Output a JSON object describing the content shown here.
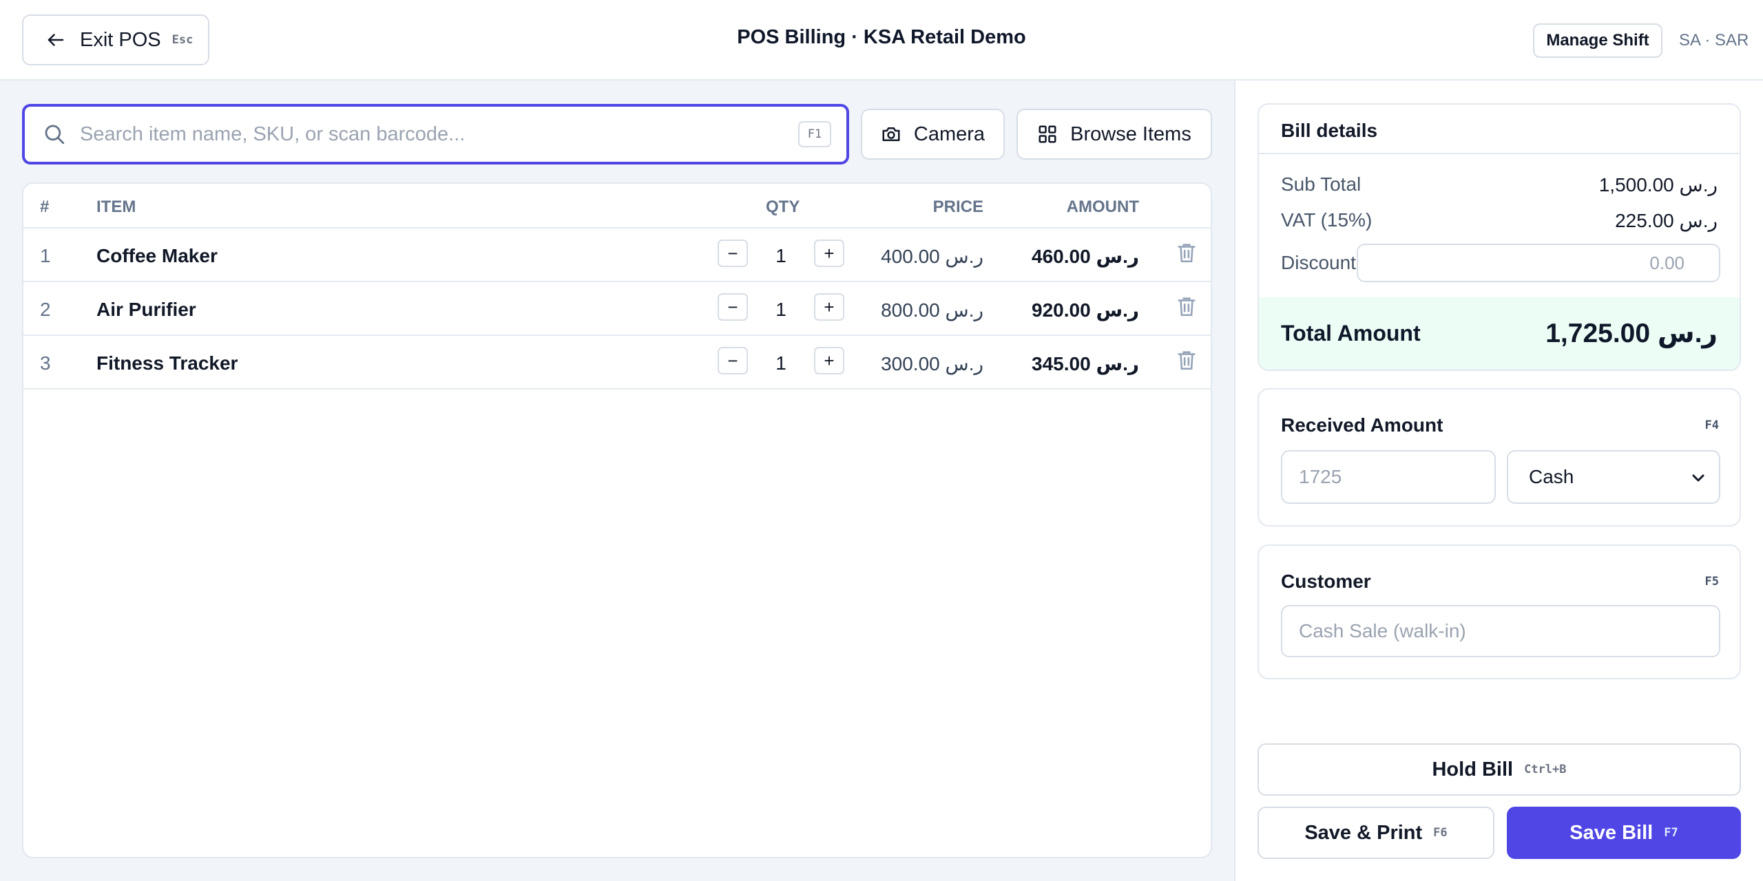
{
  "header": {
    "exit_label": "Exit POS",
    "exit_shortcut": "Esc",
    "title": "POS Billing · KSA Retail Demo",
    "manage_shift": "Manage Shift",
    "locale": "SA · SAR"
  },
  "search": {
    "placeholder": "Search item name, SKU, or scan barcode...",
    "shortcut": "F1"
  },
  "toolbar": {
    "camera": "Camera",
    "browse": "Browse Items"
  },
  "table": {
    "headers": {
      "num": "#",
      "item": "ITEM",
      "qty": "QTY",
      "price": "PRICE",
      "amount": "AMOUNT"
    },
    "rows": [
      {
        "num": "1",
        "item": "Coffee Maker",
        "qty": "1",
        "price": "400.00 ر.س",
        "amount": "460.00 ر.س"
      },
      {
        "num": "2",
        "item": "Air Purifier",
        "qty": "1",
        "price": "800.00 ر.س",
        "amount": "920.00 ر.س"
      },
      {
        "num": "3",
        "item": "Fitness Tracker",
        "qty": "1",
        "price": "300.00 ر.س",
        "amount": "345.00 ر.س"
      }
    ],
    "minus_symbol": "−",
    "plus_symbol": "+"
  },
  "bill": {
    "title": "Bill details",
    "subtotal_label": "Sub Total",
    "subtotal_value": "1,500.00 ر.س",
    "vat_label": "VAT (15%)",
    "vat_value": "225.00 ر.س",
    "discount_label": "Discount",
    "discount_placeholder": "0.00",
    "total_label": "Total Amount",
    "total_value": "1,725.00 ر.س"
  },
  "received": {
    "title": "Received Amount",
    "shortcut": "F4",
    "placeholder": "1725",
    "payment_method": "Cash"
  },
  "customer": {
    "title": "Customer",
    "shortcut": "F5",
    "placeholder": "Cash Sale (walk-in)"
  },
  "actions": {
    "hold": "Hold Bill",
    "hold_shortcut": "Ctrl+B",
    "save_print": "Save & Print",
    "save_print_shortcut": "F6",
    "save": "Save Bill",
    "save_shortcut": "F7"
  },
  "colors": {
    "accent": "#4f46e5",
    "total_bg": "#ecfdf5"
  }
}
